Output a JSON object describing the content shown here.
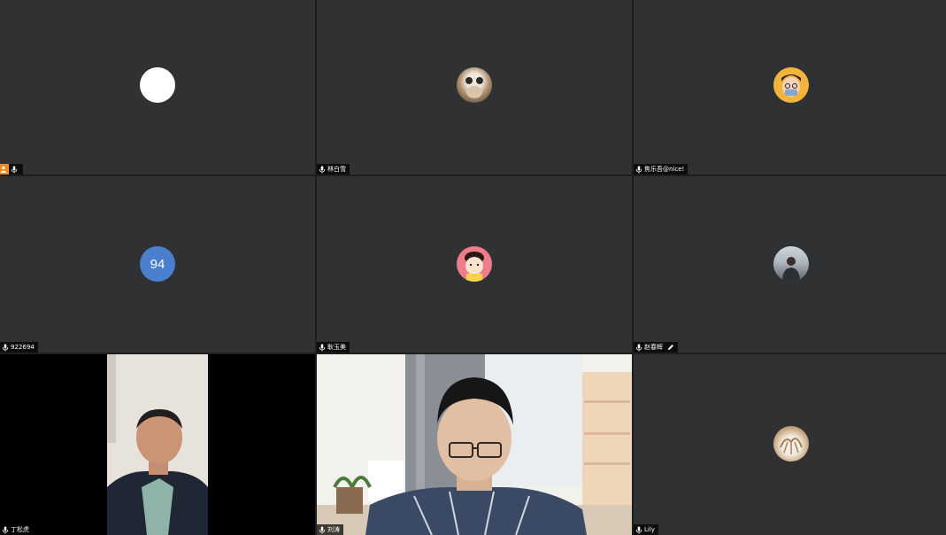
{
  "meeting": {
    "tiles": [
      {
        "id": "t1",
        "name": "",
        "avatar_style": "white",
        "host": true
      },
      {
        "id": "t2",
        "name": "林白雪",
        "avatar_style": "cat-photo"
      },
      {
        "id": "t3",
        "name": "焦乐吾@nice!",
        "avatar_style": "cartoon-face"
      },
      {
        "id": "t4",
        "name": "922694",
        "avatar_text": "94",
        "avatar_color": "#4a7fd0"
      },
      {
        "id": "t5",
        "name": "耿玉美",
        "avatar_style": "pink-cartoon"
      },
      {
        "id": "t6",
        "name": "赵春辉",
        "avatar_style": "person-photo",
        "editable": true
      },
      {
        "id": "t7",
        "name": "丁松虎",
        "video": true
      },
      {
        "id": "t8",
        "name": "刘涛",
        "video": true
      },
      {
        "id": "t9",
        "name": "Lily",
        "avatar_style": "wheat-photo"
      }
    ]
  },
  "colors": {
    "tile_bg": "#303133",
    "grid_gap": "#1c1d1f",
    "host_badge": "#f08a24",
    "avatar_blue": "#4a7fd0",
    "namebar_bg": "rgba(0,0,0,0.72)"
  },
  "icons": {
    "mic": "mic-icon",
    "host": "host-badge-icon",
    "edit": "pencil-icon"
  }
}
